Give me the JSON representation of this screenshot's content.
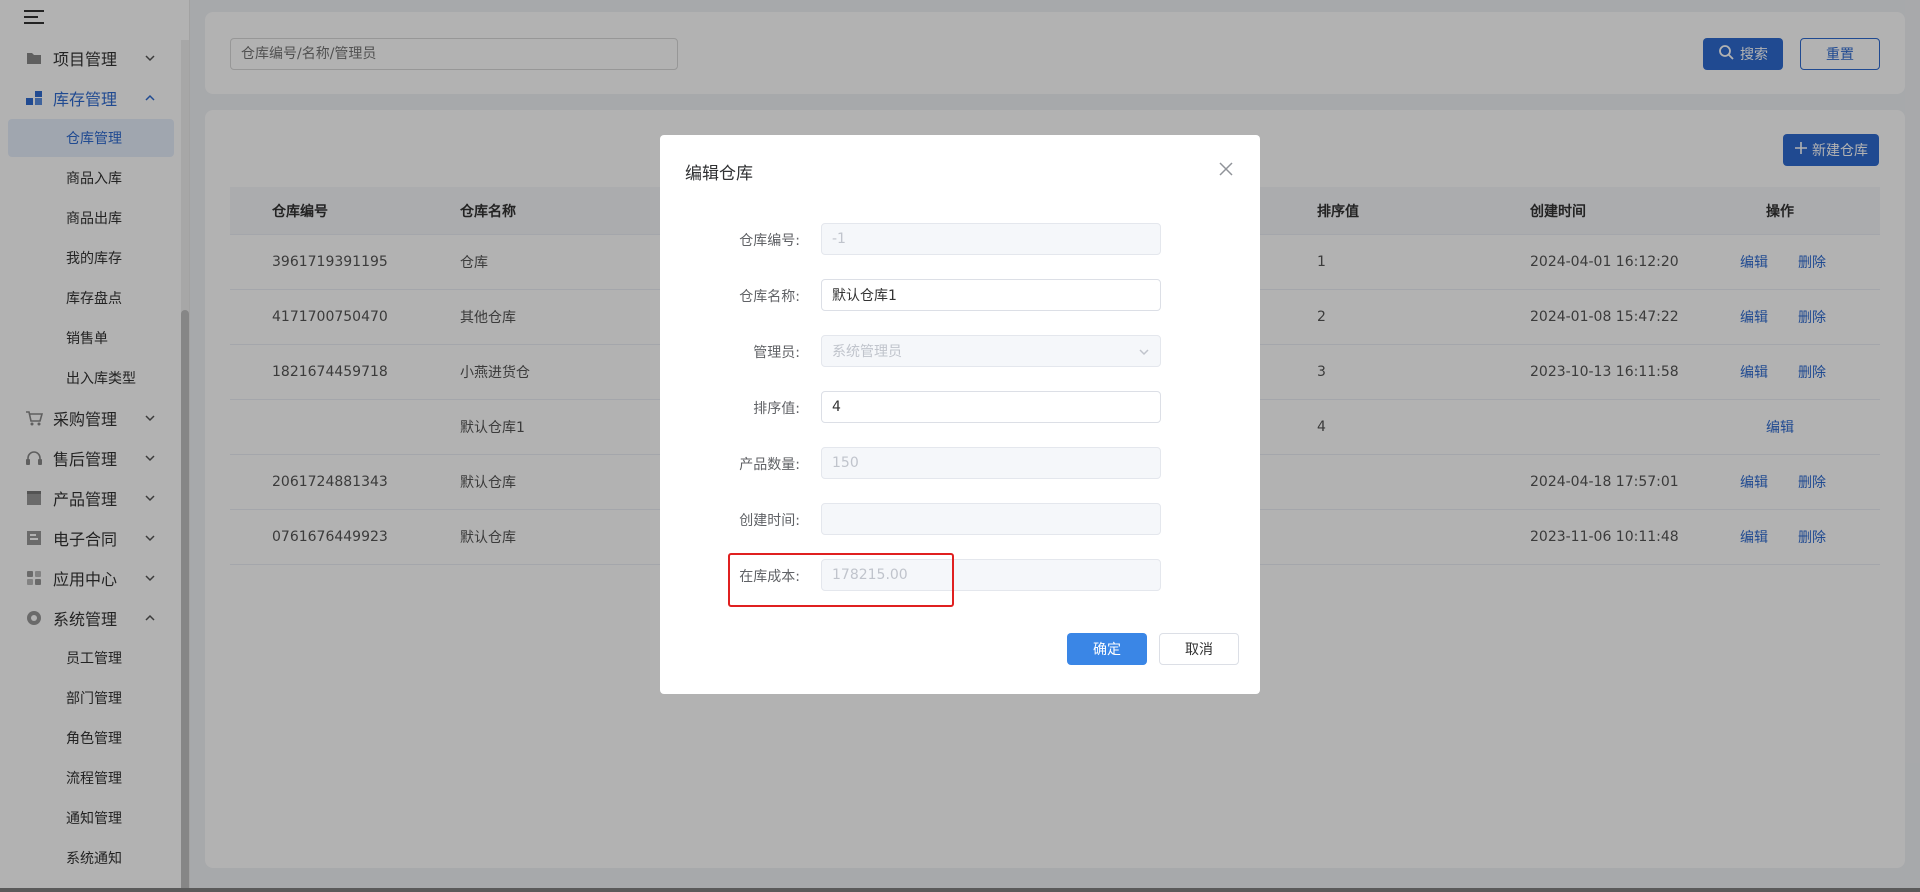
{
  "sidebar": {
    "groups": [
      {
        "label": "项目管理",
        "icon": "folder-icon"
      },
      {
        "label": "库存管理",
        "icon": "inventory-icon"
      },
      {
        "label": "采购管理",
        "icon": "cart-icon"
      },
      {
        "label": "售后管理",
        "icon": "headset-icon"
      },
      {
        "label": "产品管理",
        "icon": "box-icon"
      },
      {
        "label": "电子合同",
        "icon": "contract-icon"
      },
      {
        "label": "应用中心",
        "icon": "apps-icon"
      },
      {
        "label": "系统管理",
        "icon": "gear-icon"
      }
    ],
    "inventory_items": [
      "仓库管理",
      "商品入库",
      "商品出库",
      "我的库存",
      "库存盘点",
      "销售单",
      "出入库类型"
    ],
    "system_items": [
      "员工管理",
      "部门管理",
      "角色管理",
      "流程管理",
      "通知管理",
      "系统通知"
    ]
  },
  "search": {
    "placeholder": "仓库编号/名称/管理员",
    "search_label": "搜索",
    "reset_label": "重置"
  },
  "table": {
    "new_label": "新建仓库",
    "headers": {
      "code": "仓库编号",
      "name": "仓库名称",
      "sort": "排序值",
      "created": "创建时间",
      "actions": "操作"
    },
    "edit_label": "编辑",
    "delete_label": "删除",
    "rows": [
      {
        "code": "3961719391195",
        "name": "仓库",
        "sort": "1",
        "created": "2024-04-01 16:12:20"
      },
      {
        "code": "4171700750470",
        "name": "其他仓库",
        "sort": "2",
        "created": "2024-01-08 15:47:22"
      },
      {
        "code": "1821674459718",
        "name": "小燕进货仓",
        "sort": "3",
        "created": "2023-10-13 16:11:58"
      },
      {
        "code": "",
        "name": "默认仓库1",
        "sort": "4",
        "created": ""
      },
      {
        "code": "2061724881343",
        "name": "默认仓库",
        "sort": "",
        "created": "2024-04-18 17:57:01"
      },
      {
        "code": "0761676449923",
        "name": "默认仓库",
        "sort": "",
        "created": "2023-11-06 10:11:48"
      }
    ]
  },
  "dialog": {
    "title": "编辑仓库",
    "fields": {
      "code_label": "仓库编号:",
      "code_value": "-1",
      "name_label": "仓库名称:",
      "name_value": "默认仓库1",
      "manager_label": "管理员:",
      "manager_value": "系统管理员",
      "sort_label": "排序值:",
      "sort_value": "4",
      "qty_label": "产品数量:",
      "qty_value": "150",
      "created_label": "创建时间:",
      "created_value": "",
      "cost_label": "在库成本:",
      "cost_value": "178215.00"
    },
    "ok_label": "确定",
    "cancel_label": "取消"
  },
  "colors": {
    "primary": "#2f6bd0",
    "highlight": "#e02020"
  }
}
